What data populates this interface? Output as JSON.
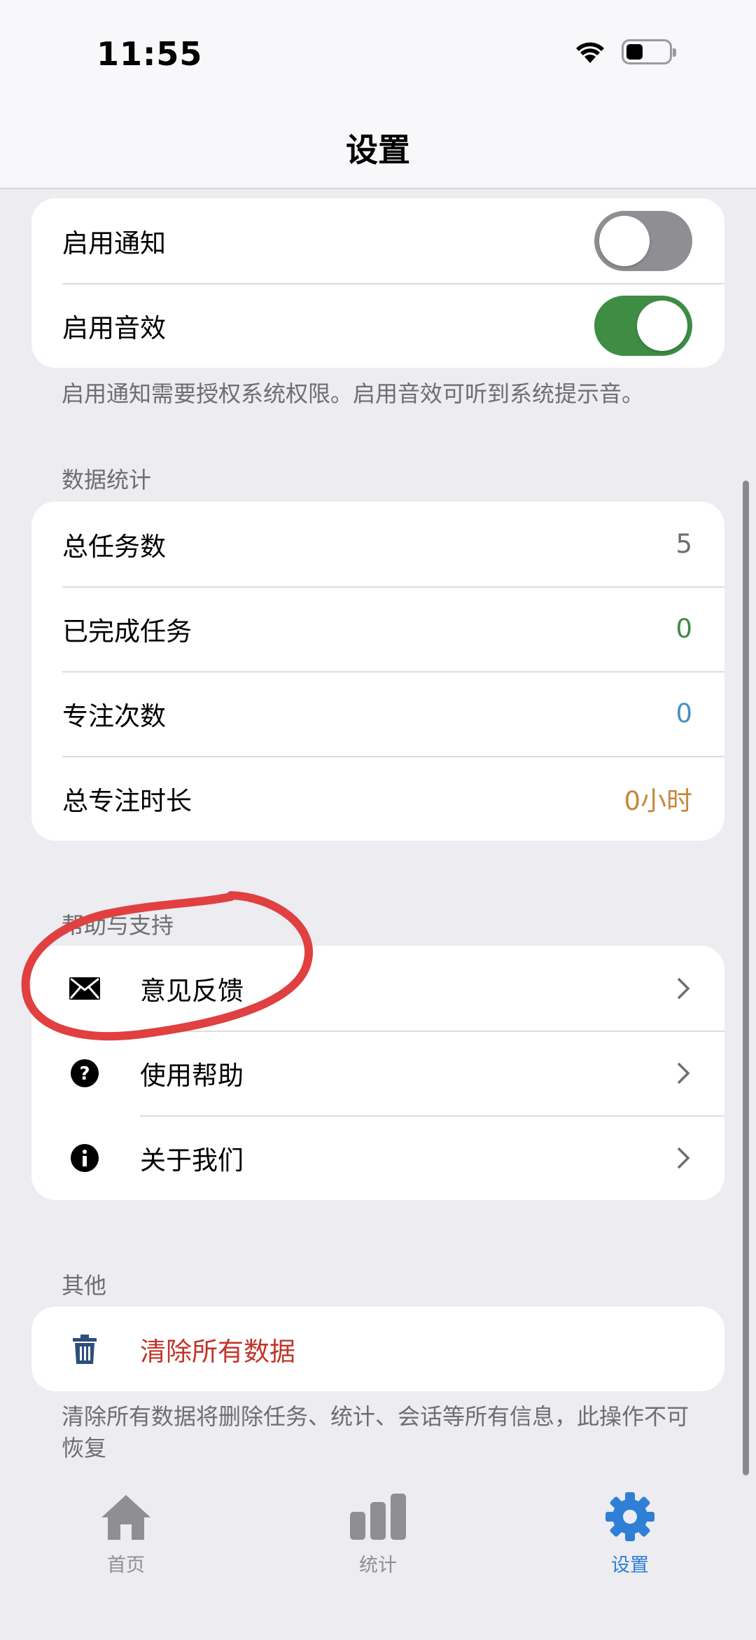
{
  "status_bar": {
    "time": "11:55"
  },
  "nav": {
    "title": "设置"
  },
  "settings": {
    "notifications": {
      "label": "启用通知",
      "enabled": false
    },
    "sound": {
      "label": "启用音效",
      "enabled": true
    },
    "footnote": "启用通知需要授权系统权限。启用音效可听到系统提示音。"
  },
  "stats": {
    "header": "数据统计",
    "rows": [
      {
        "label": "总任务数",
        "value": "5",
        "color": "#6d6d72"
      },
      {
        "label": "已完成任务",
        "value": "0",
        "color": "#3f8d44"
      },
      {
        "label": "专注次数",
        "value": "0",
        "color": "#4a90c4"
      },
      {
        "label": "总专注时长",
        "value": "0小时",
        "color": "#c7873a"
      }
    ]
  },
  "help": {
    "header": "帮助与支持",
    "rows": [
      {
        "label": "意见反馈",
        "icon": "envelope-icon"
      },
      {
        "label": "使用帮助",
        "icon": "question-circle-icon"
      },
      {
        "label": "关于我们",
        "icon": "info-circle-icon"
      }
    ]
  },
  "other": {
    "header": "其他",
    "clear_label": "清除所有数据",
    "clear_color": "#c0352b",
    "footnote": "清除所有数据将删除任务、统计、会话等所有信息，此操作不可恢复"
  },
  "tabs": [
    {
      "label": "首页",
      "icon": "home-icon",
      "active": false
    },
    {
      "label": "统计",
      "icon": "bar-chart-icon",
      "active": false
    },
    {
      "label": "设置",
      "icon": "gear-icon",
      "active": true
    }
  ],
  "colors": {
    "active_tab": "#2f7fd6",
    "inactive_tab": "#8e8e93",
    "annotation": "#e04040"
  }
}
